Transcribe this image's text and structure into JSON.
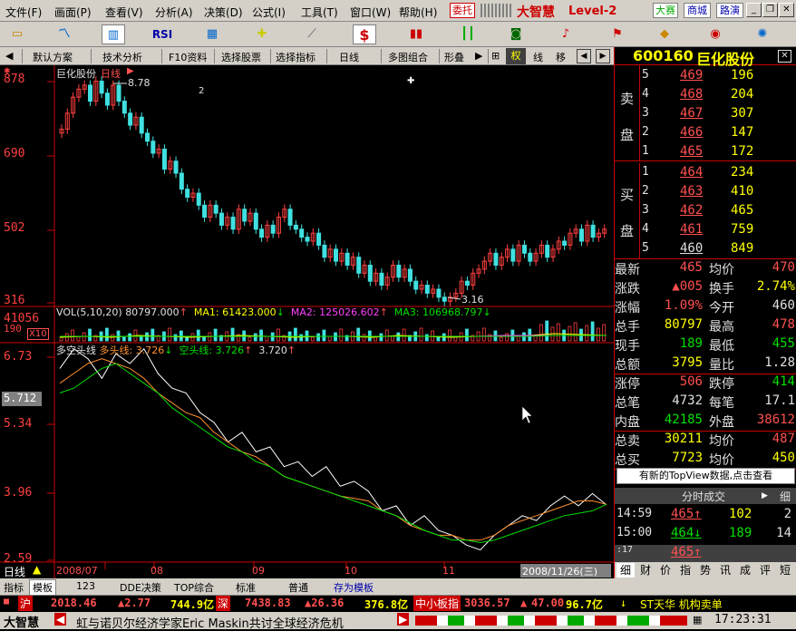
{
  "menu": {
    "items": [
      "文件(F)",
      "画面(P)",
      "查看(V)",
      "分析(A)",
      "决策(D)",
      "公式(I)",
      "工具(T)",
      "窗口(W)",
      "帮助(H)"
    ],
    "weituo": "委托",
    "brand": "大智慧",
    "level": "Level-2",
    "dasai": "大赛",
    "shangcheng": "商城",
    "luyan": "路演",
    "win_min": "_",
    "win_restore": "❐",
    "win_close": "✕"
  },
  "toolbar": {
    "icons": [
      "folder-icon",
      "chart-line-icon",
      "chart-bar-icon",
      "rsi-icon",
      "grid-icon",
      "crosshair-icon",
      "ruler-icon",
      "dollar-icon",
      "sticks-icon",
      "bars-icon",
      "binoculars-icon",
      "bell-icon",
      "flag-icon",
      "diamond-icon",
      "chip-icon",
      "gear-icon"
    ],
    "rsi": "RSI",
    "dollar": "$"
  },
  "tabs": {
    "left_arrow": "◀",
    "default_scheme": "默认方案",
    "tech_analysis": "技术分析",
    "f10": "F10资料",
    "select_stock": "选择股票",
    "select_indicator": "选择指标",
    "period": "日线",
    "multi_combo": "多图组合",
    "shape": "形叠",
    "right_arrow": "▶",
    "plus": "⊞",
    "quan": "权",
    "xian": "线",
    "yi": "移"
  },
  "chart": {
    "title_stock": "巨化股份",
    "title_period": "日线",
    "price_labels": [
      "878",
      "690",
      "502",
      "316"
    ],
    "high_label": "8.78",
    "low_label": "3.16",
    "marker": "2",
    "vol_line": {
      "label": "VOL(5,10,20)",
      "vol": "80797.000",
      "ma1_label": "MA1:",
      "ma1": "61423.000",
      "ma2_label": "MA2:",
      "ma2": "125026.602",
      "ma3_label": "MA3:",
      "ma3": "106968.797"
    },
    "vol_labels": [
      "41056",
      "190"
    ],
    "vol_unit": "X10",
    "dk_line": {
      "label": "多空头线",
      "duo_label": "多头线:",
      "duo": "3.726",
      "kong_label": "空头线:",
      "kong": "3.726",
      "v3": "3.720"
    },
    "dk_labels": [
      "6.73",
      "5.34",
      "3.96",
      "2.59"
    ],
    "cursor_value": "5.712",
    "period_label": "日线",
    "date_labels": [
      "2008/07",
      "08",
      "09",
      "10",
      "11"
    ],
    "date_box": "2008/11/26(三)"
  },
  "chart_data": {
    "type": "line",
    "title": "巨化股份 日线",
    "ylim": [
      3.16,
      8.78
    ],
    "candles_close": [
      7.5,
      7.9,
      8.3,
      8.5,
      8.6,
      8.2,
      8.7,
      8.4,
      8.1,
      8.6,
      8.2,
      7.9,
      7.6,
      7.8,
      7.4,
      7.2,
      6.9,
      7.0,
      6.5,
      6.7,
      6.4,
      6.0,
      5.8,
      5.9,
      5.6,
      5.3,
      5.6,
      5.4,
      5.1,
      5.3,
      5.0,
      5.5,
      5.2,
      5.4,
      5.0,
      4.8,
      5.1,
      4.9,
      5.3,
      5.5,
      5.1,
      5.0,
      4.8,
      4.7,
      4.9,
      4.6,
      4.3,
      4.5,
      4.2,
      4.4,
      4.1,
      4.3,
      3.9,
      4.1,
      3.7,
      3.9,
      3.6,
      3.8,
      4.1,
      3.8,
      4.0,
      3.7,
      3.5,
      3.6,
      3.4,
      3.5,
      3.3,
      3.2,
      3.3,
      3.4,
      3.7,
      3.6,
      3.9,
      4.0,
      4.2,
      4.4,
      4.1,
      4.3,
      4.5,
      4.2,
      4.6,
      4.4,
      4.2,
      4.4,
      4.6,
      4.3,
      4.5,
      4.7,
      4.6,
      4.9,
      5.0,
      4.7,
      5.1,
      4.8,
      4.9,
      5.0
    ],
    "duo_series": [
      6.2,
      6.4,
      6.6,
      6.7,
      6.6,
      6.5,
      6.3,
      6.0,
      5.8,
      5.6,
      5.5,
      5.2,
      5.0,
      4.8,
      4.7,
      4.5,
      4.3,
      4.2,
      4.1,
      4.0,
      3.9,
      3.85,
      3.8,
      3.6,
      3.5,
      3.3,
      3.2,
      3.1,
      3.1,
      3.0,
      3.0,
      3.1,
      3.3,
      3.4,
      3.5,
      3.6,
      3.7,
      3.8,
      3.8,
      3.73
    ],
    "kong_series": [
      6.0,
      6.1,
      6.3,
      6.5,
      6.6,
      6.4,
      6.2,
      6.0,
      5.7,
      5.5,
      5.3,
      5.1,
      4.9,
      4.8,
      4.6,
      4.5,
      4.3,
      4.2,
      4.1,
      4.0,
      3.9,
      3.8,
      3.7,
      3.6,
      3.5,
      3.35,
      3.2,
      3.1,
      3.0,
      3.0,
      2.95,
      3.0,
      3.1,
      3.2,
      3.3,
      3.4,
      3.5,
      3.55,
      3.6,
      3.73
    ],
    "raw_series": [
      6.5,
      6.9,
      6.7,
      6.3,
      6.8,
      6.6,
      6.9,
      6.4,
      6.1,
      6.0,
      5.6,
      5.4,
      5.0,
      5.2,
      4.8,
      4.9,
      4.5,
      4.6,
      4.3,
      4.5,
      4.1,
      4.2,
      4.0,
      3.6,
      3.7,
      3.3,
      3.5,
      3.2,
      3.1,
      2.9,
      2.8,
      3.1,
      3.3,
      3.5,
      3.4,
      3.7,
      3.9,
      3.7,
      3.95,
      3.72
    ]
  },
  "quote": {
    "code": "600160",
    "name": "巨化股份",
    "sell_label": [
      "卖",
      "盘"
    ],
    "buy_label": [
      "买",
      "盘"
    ],
    "asks": [
      {
        "lv": "5",
        "p": "469",
        "v": "196"
      },
      {
        "lv": "4",
        "p": "468",
        "v": "204"
      },
      {
        "lv": "3",
        "p": "467",
        "v": "307"
      },
      {
        "lv": "2",
        "p": "466",
        "v": "147"
      },
      {
        "lv": "1",
        "p": "465",
        "v": "172"
      }
    ],
    "bids": [
      {
        "lv": "1",
        "p": "464",
        "v": "234"
      },
      {
        "lv": "2",
        "p": "463",
        "v": "410"
      },
      {
        "lv": "3",
        "p": "462",
        "v": "465"
      },
      {
        "lv": "4",
        "p": "461",
        "v": "759"
      },
      {
        "lv": "5",
        "p": "460",
        "v": "849"
      }
    ],
    "stats": [
      {
        "k1": "最新",
        "v1": "465",
        "k2": "均价",
        "v2": "470"
      },
      {
        "k1": "涨跌",
        "v1": "▲005",
        "k2": "换手",
        "v2": "2.74%"
      },
      {
        "k1": "涨幅",
        "v1": "1.09%",
        "k2": "今开",
        "v2": "460"
      },
      {
        "k1": "总手",
        "v1": "80797",
        "k2": "最高",
        "v2": "478"
      },
      {
        "k1": "现手",
        "v1": "189",
        "k2": "最低",
        "v2": "455"
      },
      {
        "k1": "总额",
        "v1": "3795",
        "k2": "量比",
        "v2": "1.28"
      },
      {
        "k1": "涨停",
        "v1": "506",
        "k2": "跌停",
        "v2": "414"
      },
      {
        "k1": "总笔",
        "v1": "4732",
        "k2": "每笔",
        "v2": "17.1"
      },
      {
        "k1": "内盘",
        "v1": "42185",
        "k2": "外盘",
        "v2": "38612"
      },
      {
        "k1": "总卖",
        "v1": "30211",
        "k2": "均价",
        "v2": "487"
      },
      {
        "k1": "总买",
        "v1": "7723",
        "k2": "均价",
        "v2": "450"
      }
    ],
    "topview": "有新的TopView数据,点击查看",
    "ticks_header": "分时成交",
    "ticks_detail": "细",
    "ticks": [
      {
        "t": "14:59",
        "p": "465↑",
        "v": "102",
        "n": "2"
      },
      {
        "t": "15:00",
        "p": "464↓",
        "v": "189",
        "n": "14"
      },
      {
        "t": ":17",
        "p": "465↑",
        "v": "",
        "n": ""
      }
    ],
    "bottom_tabs": [
      "细",
      "财",
      "价",
      "指",
      "势",
      "讯",
      "成",
      "评",
      "短"
    ]
  },
  "bottom_tabs": [
    "指标",
    "模板",
    "123",
    "DDE决策",
    "TOP综合",
    "标准",
    "普通",
    "存为模板"
  ],
  "index_bar": {
    "hu": "沪",
    "hu_val": "2018.46",
    "hu_chg": "▲2.77",
    "hu_amt": "744.9亿",
    "shen": "深",
    "shen_val": "7438.83",
    "shen_chg": "▲26.36",
    "shen_amt": "376.8亿",
    "zx": "中小板指",
    "zx_val": "3036.57",
    "zx_chg": "47.00",
    "zx_amt": "96.7亿",
    "news": "ST天华 机构卖单"
  },
  "status": {
    "brand": "大智慧",
    "ticker": "虹与诺贝尔经济学家Eric Maskin共讨全球经济危机",
    "time": "17:23:31"
  }
}
